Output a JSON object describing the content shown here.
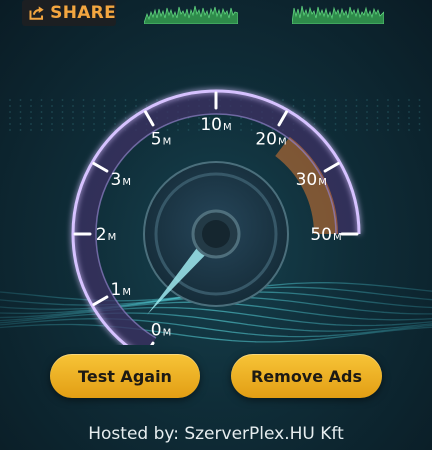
{
  "share": {
    "label": "SHARE",
    "icon": "share-icon"
  },
  "gauge": {
    "ticks": [
      {
        "num": "0",
        "unit": "M"
      },
      {
        "num": "1",
        "unit": "M"
      },
      {
        "num": "2",
        "unit": "M"
      },
      {
        "num": "3",
        "unit": "M"
      },
      {
        "num": "5",
        "unit": "M"
      },
      {
        "num": "10",
        "unit": "M"
      },
      {
        "num": "20",
        "unit": "M"
      },
      {
        "num": "30",
        "unit": "M"
      },
      {
        "num": "50",
        "unit": "M"
      }
    ],
    "needle_tick_position": 0.35,
    "colors": {
      "arc": "#b08cff",
      "accent": "#f08a3a",
      "needle": "#9fe9ee"
    }
  },
  "buttons": {
    "test_again": "Test Again",
    "remove_ads": "Remove Ads"
  },
  "hosted_by": "Hosted by: SzerverPlex.HU Kft"
}
